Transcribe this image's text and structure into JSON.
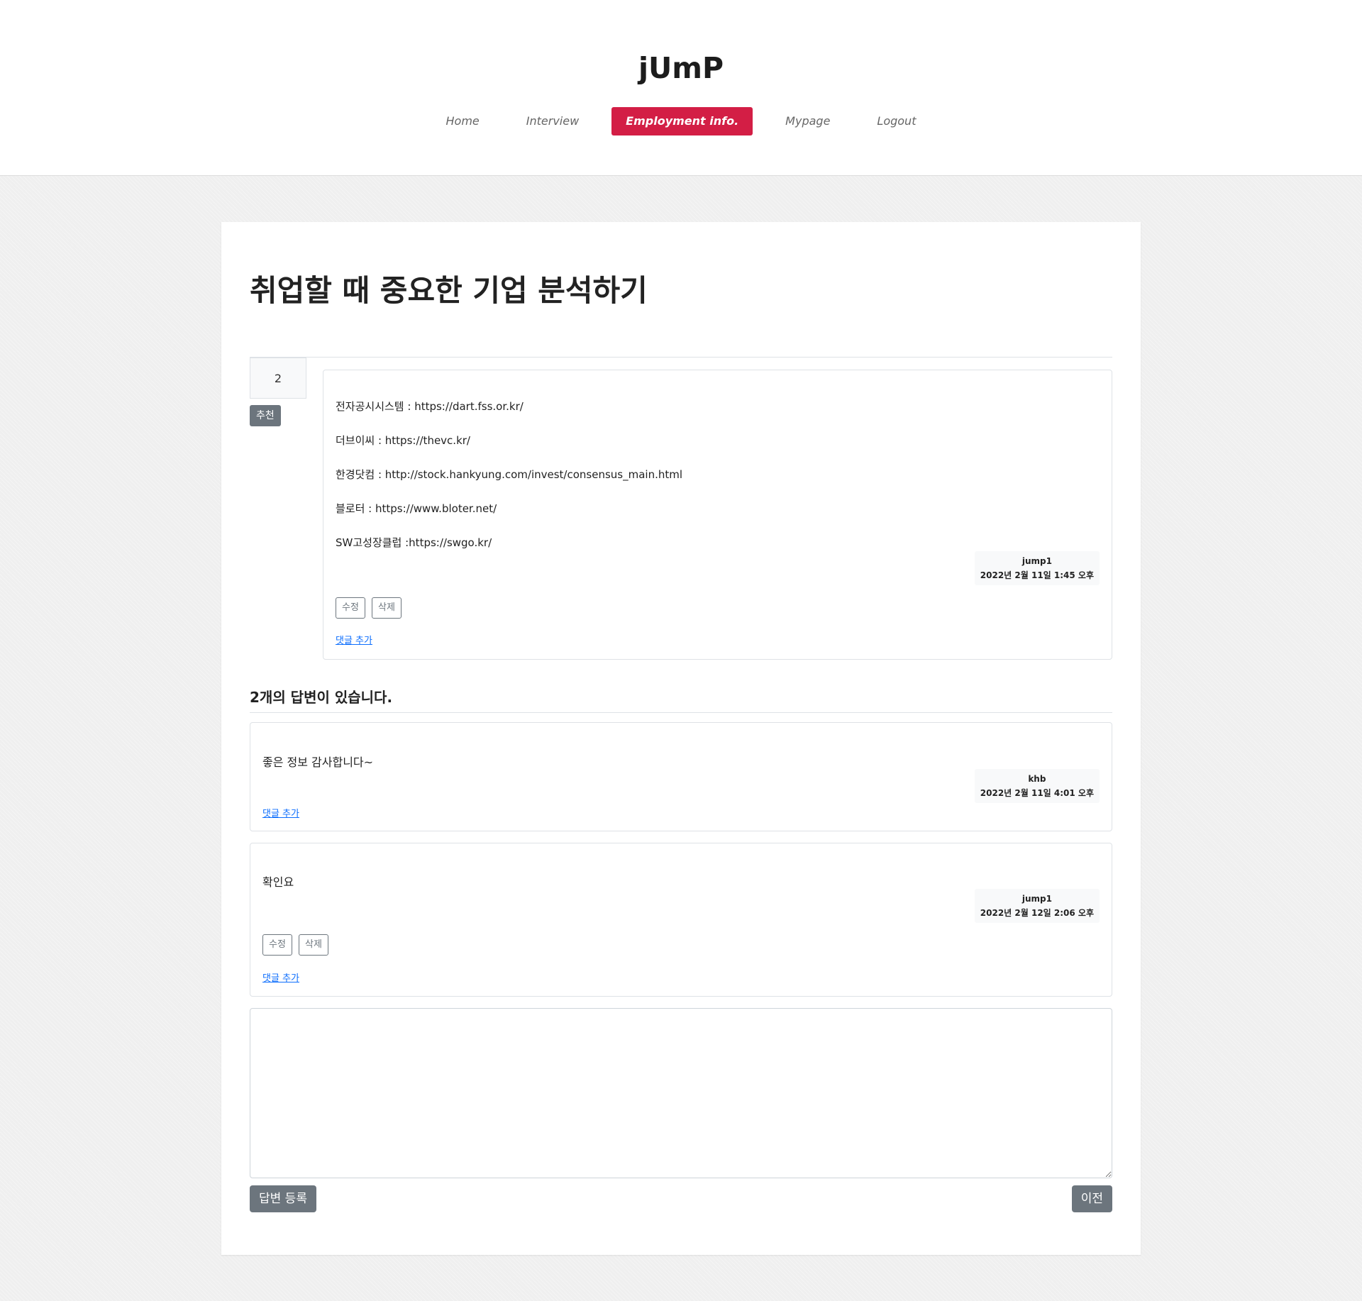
{
  "header": {
    "brand": "jUmP",
    "nav": [
      {
        "label": "Home"
      },
      {
        "label": "Interview"
      },
      {
        "label": "Employment info."
      },
      {
        "label": "Mypage"
      },
      {
        "label": "Logout"
      }
    ]
  },
  "question": {
    "title": "취업할 때 중요한 기업 분석하기",
    "votes": "2",
    "recommend_label": "추천",
    "lines": [
      "전자공시시스템 : https://dart.fss.or.kr/",
      "더브이씨 : https://thevc.kr/",
      "한경닷컴 : http://stock.hankyung.com/invest/consensus_main.html",
      "블로터 : https://www.bloter.net/",
      "SW고성장클럽 :https://swgo.kr/"
    ],
    "author": "jump1",
    "date": "2022년 2월 11일 1:45 오후",
    "edit_label": "수정",
    "delete_label": "삭제",
    "comment_link": "댓글 추가"
  },
  "answers_header": "2개의 답변이 있습니다.",
  "answers": [
    {
      "text": "좋은 정보 감사합니다~",
      "author": "khb",
      "date": "2022년 2월 11일 4:01 오후",
      "comment_link": "댓글 추가"
    },
    {
      "text": "확인요",
      "author": "jump1",
      "date": "2022년 2월 12일 2:06 오후",
      "edit_label": "수정",
      "delete_label": "삭제",
      "comment_link": "댓글 추가"
    }
  ],
  "form": {
    "answer_value": "",
    "submit_label": "답변 등록",
    "back_label": "이전"
  }
}
